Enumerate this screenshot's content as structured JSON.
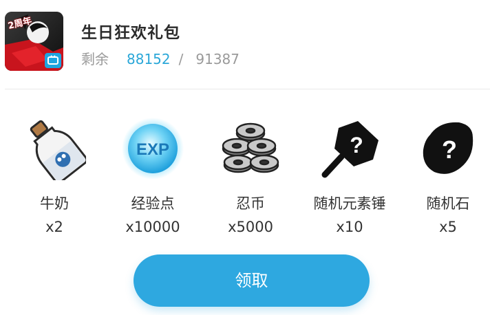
{
  "gift": {
    "title": "生日狂欢礼包",
    "remain_label": "剩余",
    "remain_count": "88152",
    "separator": "/",
    "total_count": "91387",
    "icon_badge": "2周年"
  },
  "items": [
    {
      "name": "牛奶",
      "qty": "x2",
      "icon": "milk-bottle-icon"
    },
    {
      "name": "经验点",
      "qty": "x10000",
      "icon": "exp-orb-icon",
      "icon_text": "EXP"
    },
    {
      "name": "忍币",
      "qty": "x5000",
      "icon": "ninja-coins-icon"
    },
    {
      "name": "随机元素锤",
      "qty": "x10",
      "icon": "random-hammer-icon",
      "icon_text": "?"
    },
    {
      "name": "随机石",
      "qty": "x5",
      "icon": "random-stone-icon",
      "icon_text": "?"
    }
  ],
  "claim_button": {
    "label": "领取"
  },
  "colors": {
    "accent": "#2ea8e0",
    "count_blue": "#2aa7d8",
    "text": "#333333",
    "muted": "#9a9a9a"
  }
}
